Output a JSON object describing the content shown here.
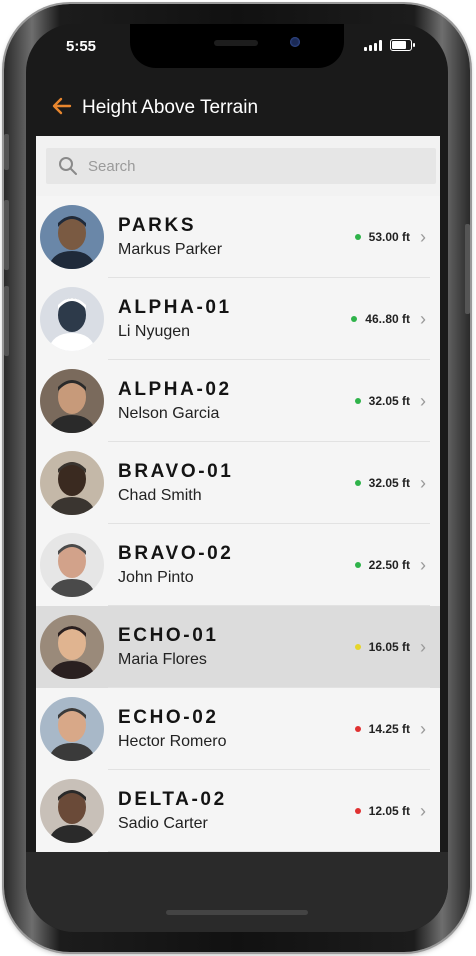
{
  "status_bar": {
    "time": "5:55"
  },
  "header": {
    "title": "Height Above Terrain",
    "back_icon": "arrow-left-icon",
    "accent": "#e8862e"
  },
  "search": {
    "placeholder": "Search"
  },
  "status_colors": {
    "green": "#2fb34a",
    "yellow": "#e6d52a",
    "red": "#e03131"
  },
  "team": [
    {
      "callsign": "PARKS",
      "name": "Markus Parker",
      "height": "53.00 ft",
      "status": "green"
    },
    {
      "callsign": "ALPHA-01",
      "name": "Li Nyugen",
      "height": "46..80 ft",
      "status": "green"
    },
    {
      "callsign": "ALPHA-02",
      "name": "Nelson Garcia",
      "height": "32.05 ft",
      "status": "green"
    },
    {
      "callsign": "BRAVO-01",
      "name": "Chad Smith",
      "height": "32.05 ft",
      "status": "green"
    },
    {
      "callsign": "BRAVO-02",
      "name": "John Pinto",
      "height": "22.50 ft",
      "status": "green"
    },
    {
      "callsign": "ECHO-01",
      "name": "Maria Flores",
      "height": "16.05 ft",
      "status": "yellow",
      "selected": true
    },
    {
      "callsign": "ECHO-02",
      "name": "Hector Romero",
      "height": "14.25 ft",
      "status": "red"
    },
    {
      "callsign": "DELTA-02",
      "name": "Sadio Carter",
      "height": "12.05 ft",
      "status": "red"
    }
  ]
}
